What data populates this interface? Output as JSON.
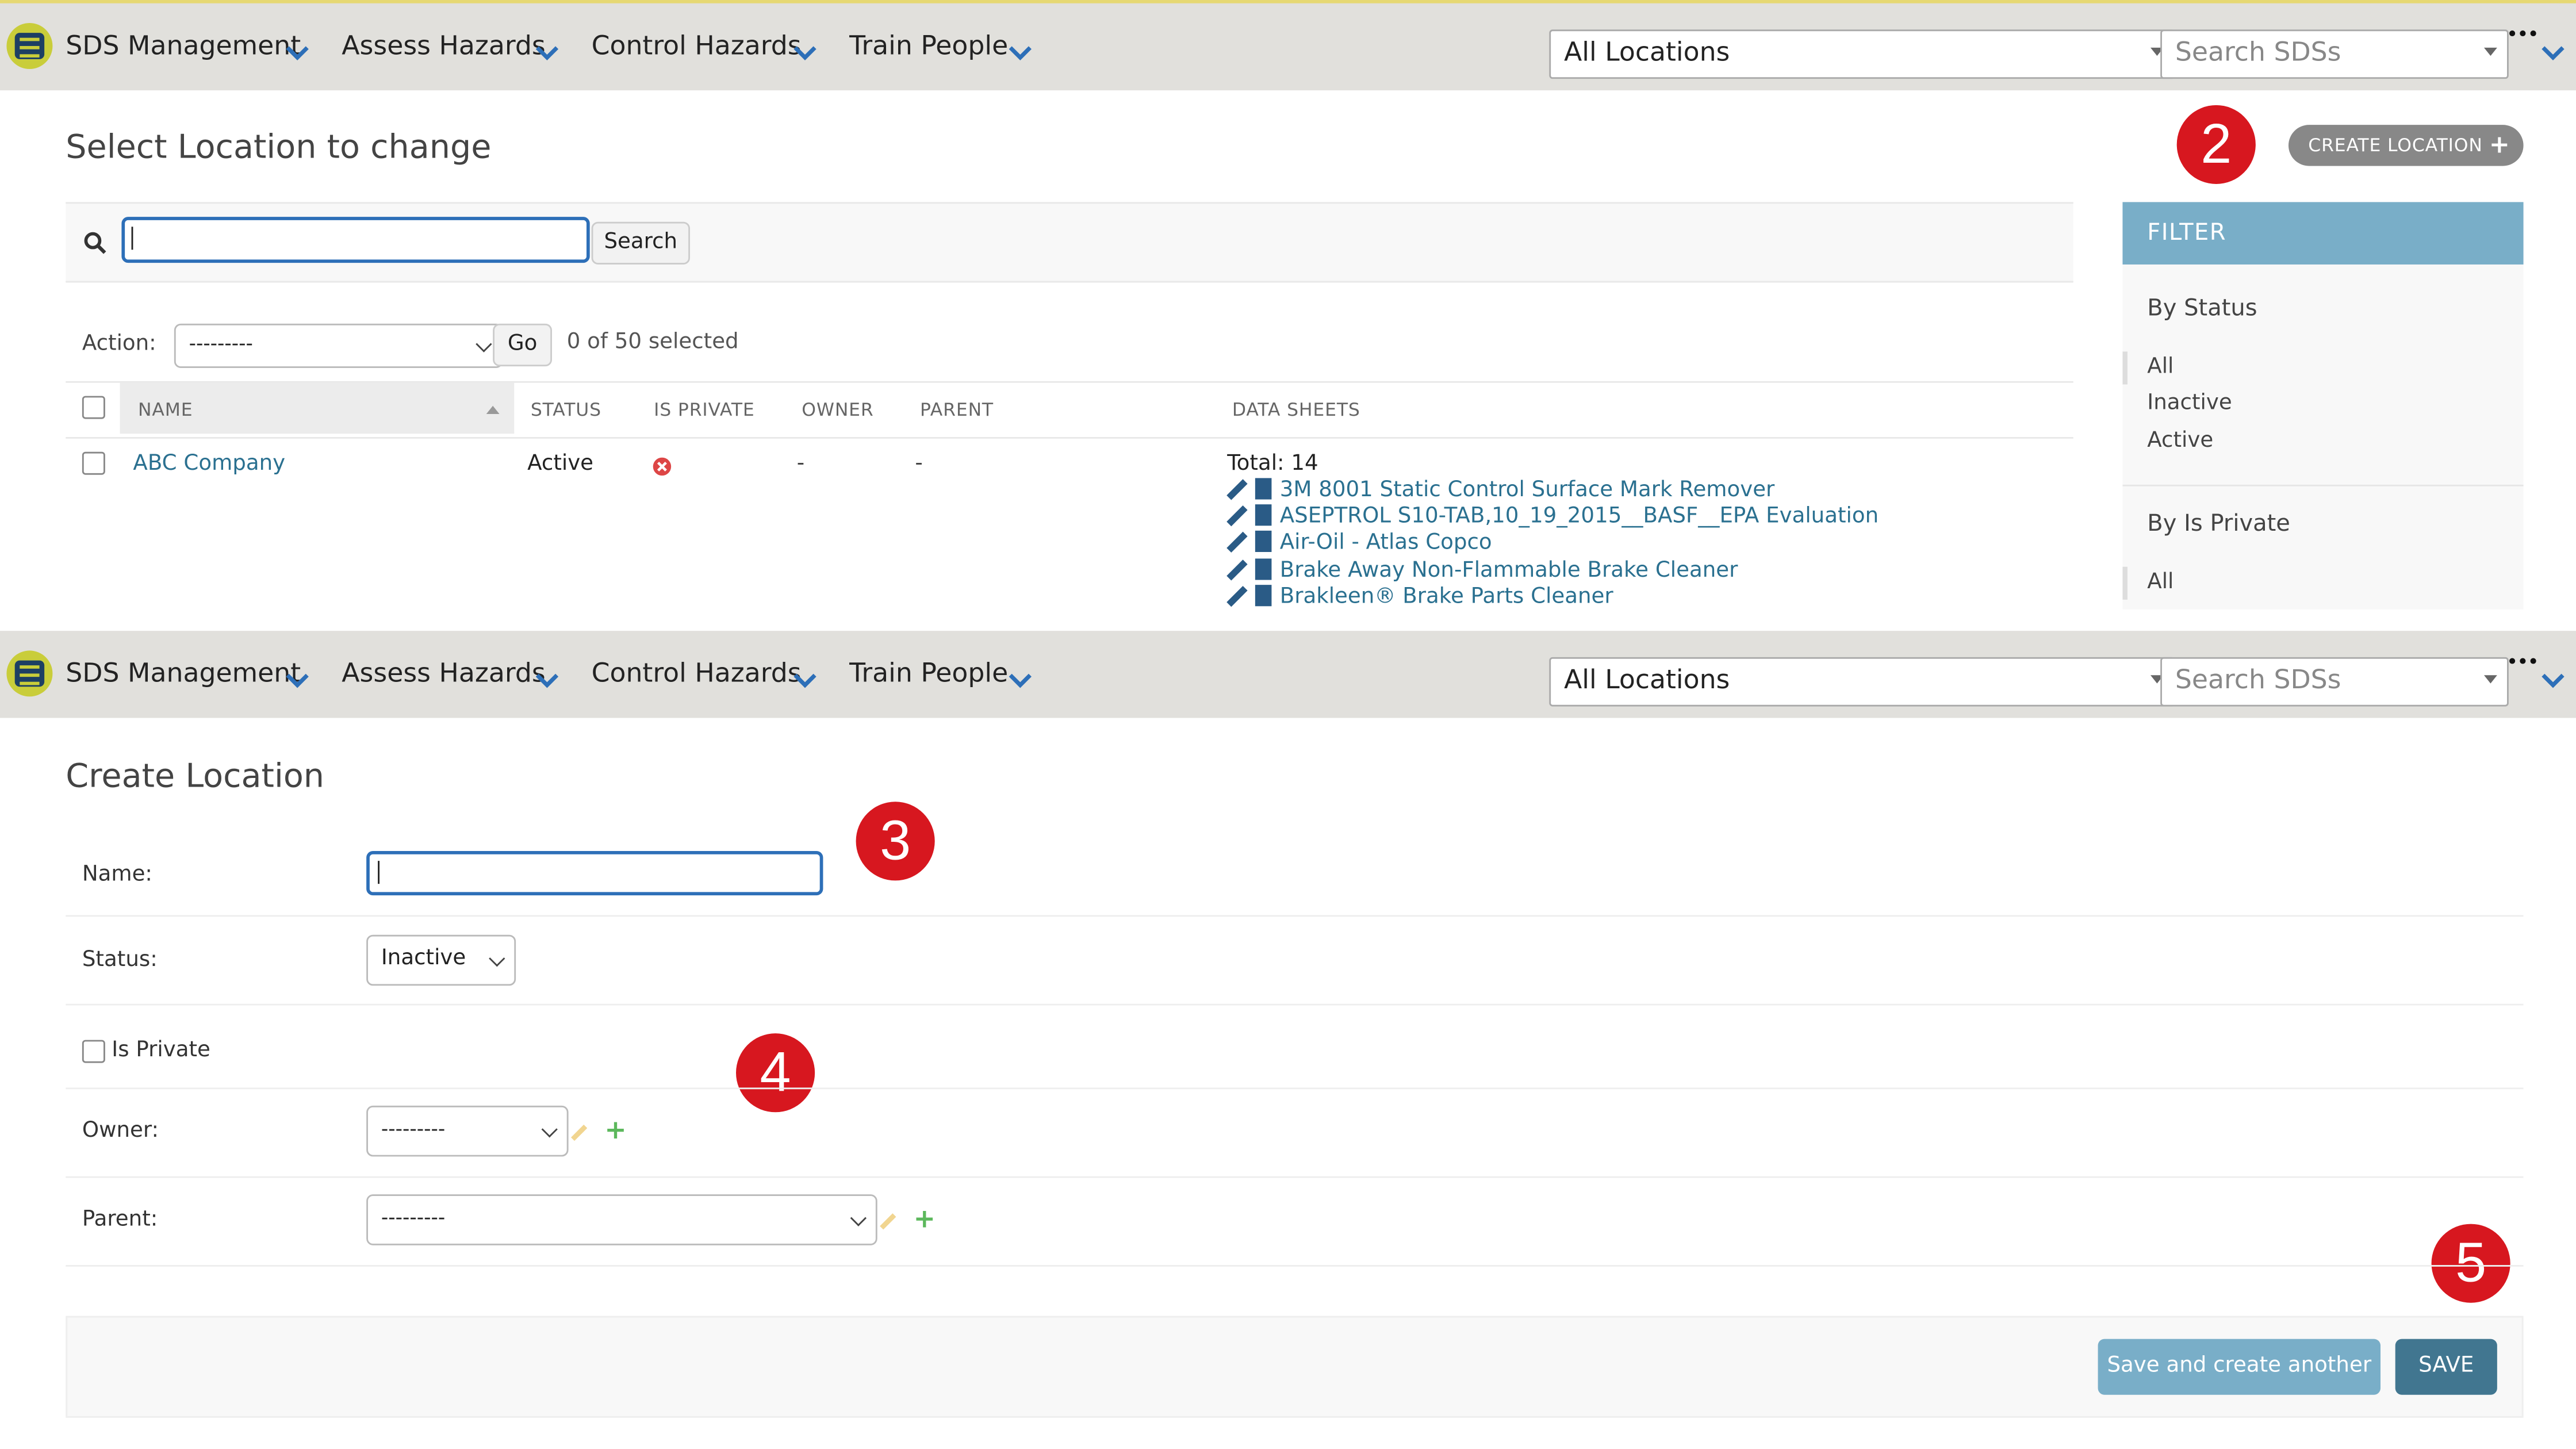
{
  "nav": {
    "items": [
      "SDS Management",
      "Assess Hazards",
      "Control Hazards",
      "Train People"
    ],
    "location_select": "All Locations",
    "search_placeholder": "Search SDSs",
    "more": "•••"
  },
  "changelist": {
    "title": "Select Location to change",
    "create_button": "CREATE LOCATION",
    "search_button": "Search",
    "action_label": "Action:",
    "action_value": "---------",
    "go_button": "Go",
    "selected_count": "0 of 50 selected",
    "columns": [
      "NAME",
      "STATUS",
      "IS PRIVATE",
      "OWNER",
      "PARENT",
      "DATA SHEETS"
    ],
    "rows": [
      {
        "name": "ABC Company",
        "status": "Active",
        "is_private": false,
        "owner": "-",
        "parent": "-",
        "data_sheets_total": "Total: 14",
        "data_sheets": [
          "3M 8001 Static Control Surface Mark Remover",
          "ASEPTROL S10-TAB,10_19_2015__BASF__EPA Evaluation",
          "Air-Oil - Atlas Copco",
          "Brake Away Non-Flammable Brake Cleaner",
          "Brakleen® Brake Parts Cleaner"
        ]
      }
    ]
  },
  "filter": {
    "title": "FILTER",
    "by_status_label": "By Status",
    "status_options": [
      "All",
      "Inactive",
      "Active"
    ],
    "by_private_label": "By Is Private",
    "private_options": [
      "All"
    ]
  },
  "form": {
    "title": "Create Location",
    "name_label": "Name:",
    "name_value": "",
    "status_label": "Status:",
    "status_value": "Inactive",
    "is_private_label": "Is Private",
    "owner_label": "Owner:",
    "owner_value": "---------",
    "parent_label": "Parent:",
    "parent_value": "---------",
    "save_another_button": "Save and create another",
    "save_button": "SAVE"
  },
  "annotations": {
    "step2": "2",
    "step3": "3",
    "step4": "4",
    "step5": "5"
  },
  "colors": {
    "accent_blue": "#2d6fb8",
    "filter_header": "#79aec8",
    "save_button": "#417690",
    "save_another_button": "#79aec8",
    "badge_red": "#d7171f",
    "link": "#2a7090",
    "topbar_bg": "#e1e0dc"
  }
}
